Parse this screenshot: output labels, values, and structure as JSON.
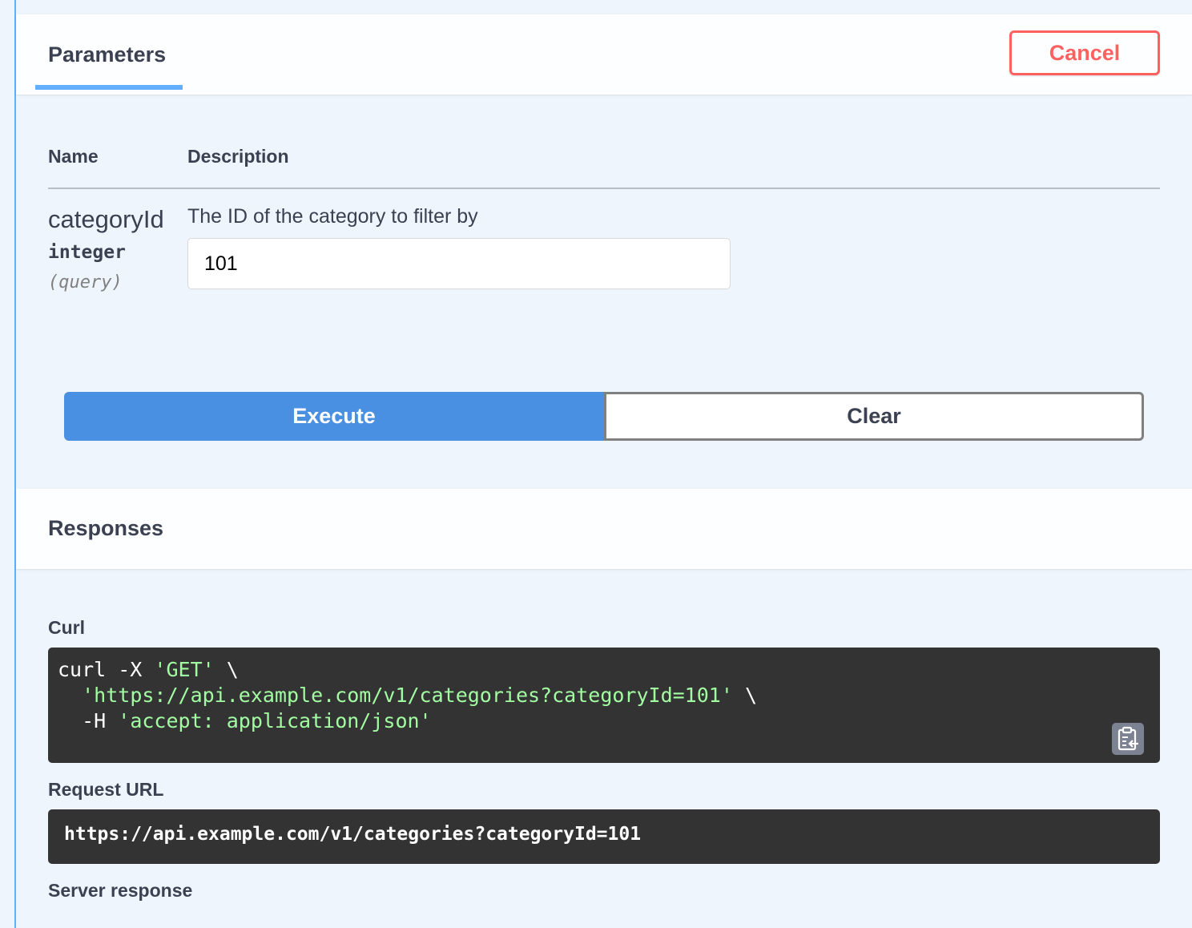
{
  "parameters": {
    "tab_label": "Parameters",
    "cancel_label": "Cancel",
    "columns": {
      "name": "Name",
      "description": "Description"
    },
    "items": [
      {
        "name": "categoryId",
        "type": "integer",
        "in": "(query)",
        "description": "The ID of the category to filter by",
        "value": "101"
      }
    ]
  },
  "actions": {
    "execute_label": "Execute",
    "clear_label": "Clear"
  },
  "responses": {
    "title": "Responses",
    "curl_label": "Curl",
    "curl": {
      "line1_cmd": "curl -X ",
      "line1_method": "'GET'",
      "line1_tail": " \\",
      "line2_indent": "  ",
      "line2_url": "'https://api.example.com/v1/categories?categoryId=101'",
      "line2_tail": " \\",
      "line3_flag": "  -H ",
      "line3_header": "'accept: application/json'"
    },
    "copy_icon": "clipboard-copy-icon",
    "request_url_label": "Request URL",
    "request_url": "https://api.example.com/v1/categories?categoryId=101",
    "server_response_label": "Server response"
  },
  "colors": {
    "accent": "#61affe",
    "execute": "#4990e2",
    "cancel": "#ff6060",
    "code_bg": "#333333",
    "code_string": "#a2fca2"
  }
}
